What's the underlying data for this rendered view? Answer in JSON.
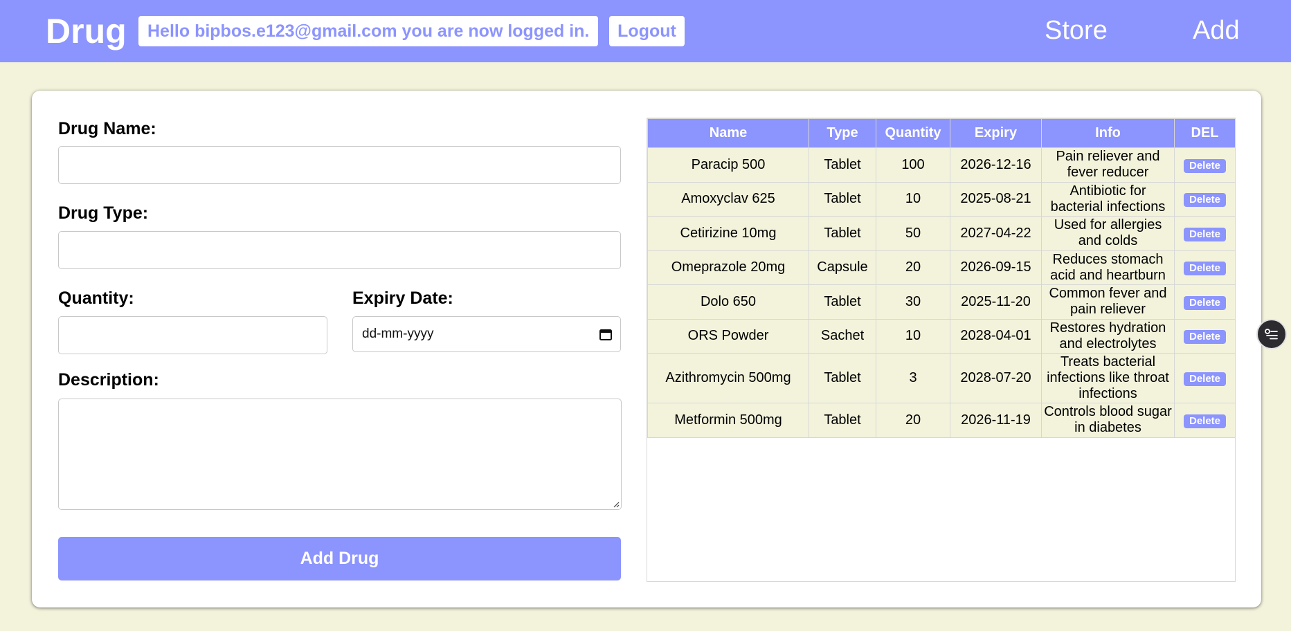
{
  "navbar": {
    "brand": "Drug",
    "greeting": "Hello bipbos.e123@gmail.com you are now logged in.",
    "logout_label": "Logout",
    "links": [
      "Store",
      "Add"
    ]
  },
  "form": {
    "name_label": "Drug Name:",
    "name_value": "",
    "type_label": "Drug Type:",
    "type_value": "",
    "quantity_label": "Quantity:",
    "quantity_value": "",
    "expiry_label": "Expiry Date:",
    "expiry_placeholder": "dd-mm-yyyy",
    "description_label": "Description:",
    "description_value": "",
    "submit_label": "Add Drug"
  },
  "table": {
    "headers": [
      "Name",
      "Type",
      "Quantity",
      "Expiry",
      "Info",
      "DEL"
    ],
    "delete_label": "Delete",
    "rows": [
      {
        "name": "Paracip 500",
        "type": "Tablet",
        "quantity": "100",
        "expiry": "2026-12-16",
        "info": "Pain reliever and fever reducer"
      },
      {
        "name": "Amoxyclav 625",
        "type": "Tablet",
        "quantity": "10",
        "expiry": "2025-08-21",
        "info": "Antibiotic for bacterial infections"
      },
      {
        "name": "Cetirizine 10mg",
        "type": "Tablet",
        "quantity": "50",
        "expiry": "2027-04-22",
        "info": "Used for allergies and colds"
      },
      {
        "name": "Omeprazole 20mg",
        "type": "Capsule",
        "quantity": "20",
        "expiry": "2026-09-15",
        "info": "Reduces stomach acid and heartburn"
      },
      {
        "name": "Dolo 650",
        "type": "Tablet",
        "quantity": "30",
        "expiry": "2025-11-20",
        "info": "Common fever and pain reliever"
      },
      {
        "name": "ORS Powder",
        "type": "Sachet",
        "quantity": "10",
        "expiry": "2028-04-01",
        "info": "Restores hydration and electrolytes"
      },
      {
        "name": "Azithromycin 500mg",
        "type": "Tablet",
        "quantity": "3",
        "expiry": "2028-07-20",
        "info": "Treats bacterial infections like throat infections"
      },
      {
        "name": "Metformin 500mg",
        "type": "Tablet",
        "quantity": "20",
        "expiry": "2026-11-19",
        "info": "Controls blood sugar in diabetes"
      }
    ]
  },
  "colors": {
    "accent": "#8c94fe",
    "page_background": "#f3f3dc",
    "card_background": "#ffffff"
  },
  "icons": {
    "calendar": "calendar-icon",
    "floating": "list-settings-icon",
    "resize": "resize-grip-icon"
  }
}
